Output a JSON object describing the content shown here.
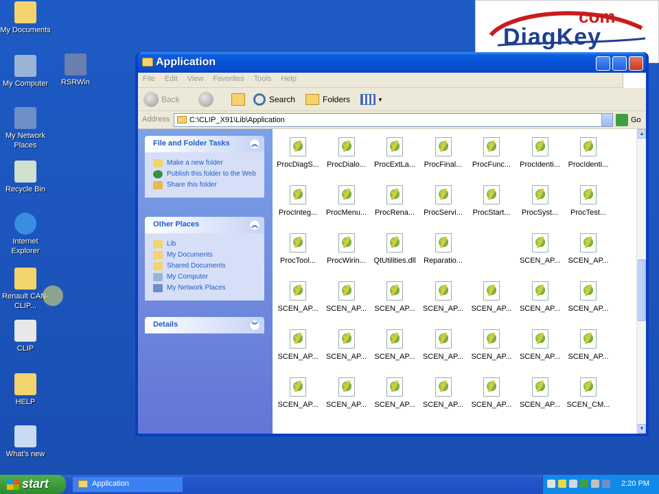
{
  "desktop": {
    "icons": [
      {
        "label": "My Documents",
        "icon": "my-documents-icon"
      },
      {
        "label": "My Computer",
        "icon": "my-computer-icon"
      },
      {
        "label": "My Network Places",
        "icon": "network-places-icon"
      },
      {
        "label": "Recycle Bin",
        "icon": "recycle-bin-icon"
      },
      {
        "label": "Internet Explorer",
        "icon": "internet-explorer-icon"
      },
      {
        "label": "Renault CAN-CLIP...",
        "icon": "folder-icon"
      },
      {
        "label": "CLIP",
        "icon": "clip-app-icon"
      },
      {
        "label": "HELP",
        "icon": "folder-icon"
      },
      {
        "label": "What's new",
        "icon": "whats-new-icon"
      },
      {
        "label": "RSRWin",
        "icon": "rsrwin-app-icon"
      }
    ]
  },
  "logo": {
    "text": "DiagKey",
    "suffix": "com"
  },
  "window": {
    "title": "Application",
    "menu": [
      "File",
      "Edit",
      "View",
      "Favorites",
      "Tools",
      "Help"
    ],
    "toolbar": {
      "back": "Back",
      "search": "Search",
      "folders": "Folders"
    },
    "address": {
      "label": "Address",
      "value": "C:\\CLIP_X91\\Lib\\Application",
      "go": "Go"
    },
    "tasks": {
      "title": "File and Folder Tasks",
      "items": [
        "Make a new folder",
        "Publish this folder to the Web",
        "Share this folder"
      ]
    },
    "other_places": {
      "title": "Other Places",
      "items": [
        "Lib",
        "My Documents",
        "Shared Documents",
        "My Computer",
        "My Network Places"
      ]
    },
    "details": {
      "title": "Details"
    },
    "files": [
      [
        "ProcDiagS...",
        "ProcDialo...",
        "ProcExtLa...",
        "ProcFinal...",
        "ProcFunc...",
        "ProcIdenti...",
        "ProcIdenti..."
      ],
      [
        "ProcInteg...",
        "ProcMenu...",
        "ProcRena...",
        "ProcServi...",
        "ProcStart...",
        "ProcSyst...",
        "ProcTest..."
      ],
      [
        "ProcTool...",
        "ProcWirin...",
        "QtUtilities.dll",
        "Reparatio...",
        "",
        "SCEN_AP...",
        "SCEN_AP..."
      ],
      [
        "SCEN_AP...",
        "SCEN_AP...",
        "SCEN_AP...",
        "SCEN_AP...",
        "SCEN_AP...",
        "SCEN_AP...",
        "SCEN_AP..."
      ],
      [
        "SCEN_AP...",
        "SCEN_AP...",
        "SCEN_AP...",
        "SCEN_AP...",
        "SCEN_AP...",
        "SCEN_AP...",
        "SCEN_AP..."
      ],
      [
        "SCEN_AP...",
        "SCEN_AP...",
        "SCEN_AP...",
        "SCEN_AP...",
        "SCEN_AP...",
        "SCEN_AP...",
        "SCEN_CM..."
      ]
    ]
  },
  "taskbar": {
    "start": "start",
    "task": "Application",
    "clock": "2:20 PM"
  },
  "colors": {
    "desktop": "#1b52b8",
    "titlebar": "#0851d6",
    "taskpane": "#7ba2e7",
    "start": "#3c9a3c"
  }
}
